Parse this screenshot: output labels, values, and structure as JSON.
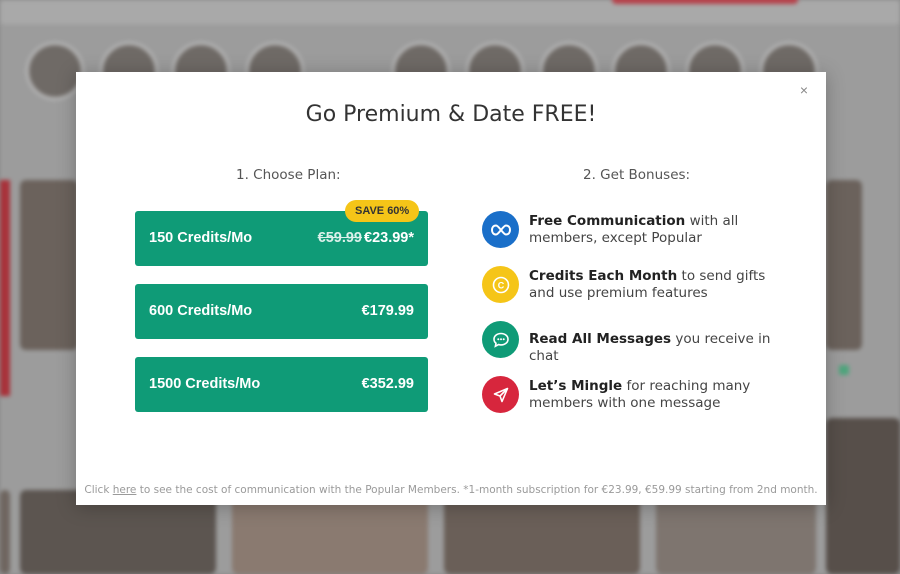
{
  "modal": {
    "close_label": "×",
    "title": "Go Premium & Date FREE!",
    "choose_plan_heading": "1. Choose Plan:",
    "bonuses_heading": "2. Get Bonuses:",
    "save_badge": "SAVE 60%",
    "plans": [
      {
        "name": "150 Credits/Mo",
        "old_price": "€59.99",
        "price": "€23.99*"
      },
      {
        "name": "600 Credits/Mo",
        "price": "€179.99"
      },
      {
        "name": "1500 Credits/Mo",
        "price": "€352.99"
      }
    ],
    "bonuses": [
      {
        "icon": "infinity-icon",
        "color": "#1a6fc9",
        "title": "Free Communication",
        "text": " with all members, except Popular"
      },
      {
        "icon": "coin-icon",
        "color": "#f5c518",
        "title": "Credits Each Month",
        "text": " to send gifts and use premium features"
      },
      {
        "icon": "chat-icon",
        "color": "#0f9b77",
        "title": "Read All Messages",
        "text": " you receive in chat"
      },
      {
        "icon": "send-icon",
        "color": "#d7263d",
        "title": "Let’s Mingle",
        "text": " for reaching many members with one message"
      }
    ],
    "footer": {
      "prefix": "Click ",
      "link": "here",
      "suffix": " to see the cost of communication with the Popular Members. *1-month subscription for €23.99, €59.99 starting from 2nd month."
    }
  },
  "colors": {
    "primary": "#0f9b77",
    "badge": "#f5c518"
  }
}
